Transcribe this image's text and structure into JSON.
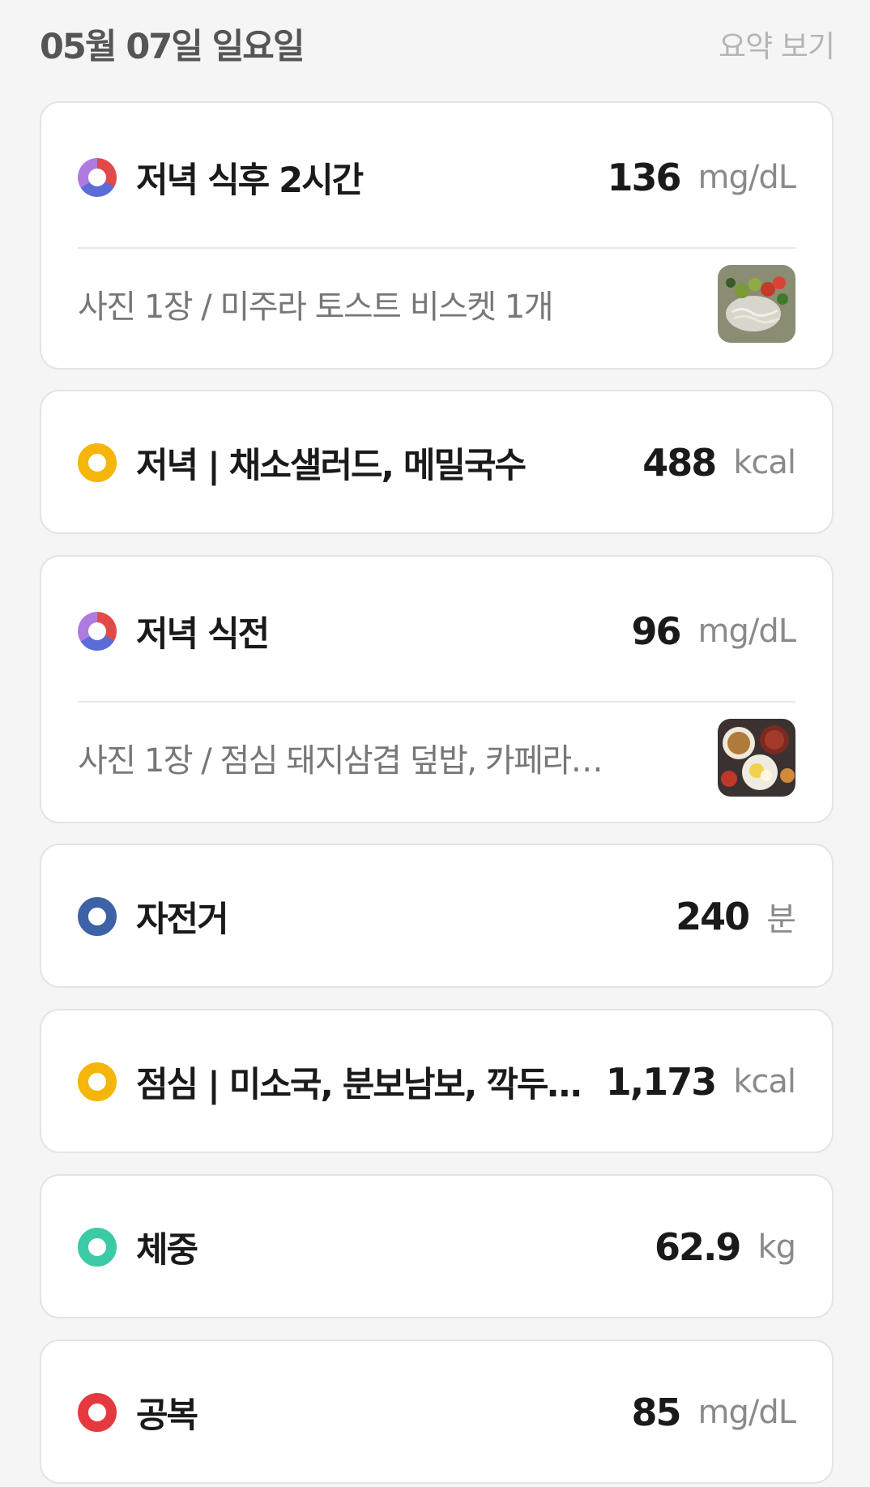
{
  "header": {
    "date": "05월 07일 일요일",
    "summary_link": "요약 보기"
  },
  "colors": {
    "meal": "#f5b50a",
    "exercise": "#3d63a6",
    "weight": "#3ccaa5",
    "fasting": "#e6393f",
    "glucose": [
      "#e24a4a",
      "#5b6bd8",
      "#b07be0"
    ]
  },
  "entries": [
    {
      "kind": "glucose",
      "icon": "glucose-ring-icon",
      "title": "저녁 식후 2시간",
      "value": "136",
      "unit": "mg/dL",
      "sub": "사진 1장 / 미주라 토스트 비스켓 1개",
      "photo": "salad-photo-thumbnail"
    },
    {
      "kind": "meal",
      "icon": "meal-ring-icon",
      "title": "저녁 | 채소샐러드, 메밀국수",
      "value": "488",
      "unit": "kcal"
    },
    {
      "kind": "glucose",
      "icon": "glucose-ring-icon",
      "title": "저녁 식전",
      "value": "96",
      "unit": "mg/dL",
      "sub": "사진 1장 / 점심 돼지삼겹 덮밥, 카페라…",
      "photo": "lunch-photo-thumbnail"
    },
    {
      "kind": "exercise",
      "icon": "exercise-ring-icon",
      "title": "자전거",
      "value": "240",
      "unit": "분"
    },
    {
      "kind": "meal",
      "icon": "meal-ring-icon",
      "title": "점심 | 미소국, 분보남보, 깍두…",
      "value": "1,173",
      "unit": "kcal"
    },
    {
      "kind": "weight",
      "icon": "weight-ring-icon",
      "title": "체중",
      "value": "62.9",
      "unit": "kg"
    },
    {
      "kind": "fasting",
      "icon": "fasting-ring-icon",
      "title": "공복",
      "value": "85",
      "unit": "mg/dL"
    }
  ]
}
